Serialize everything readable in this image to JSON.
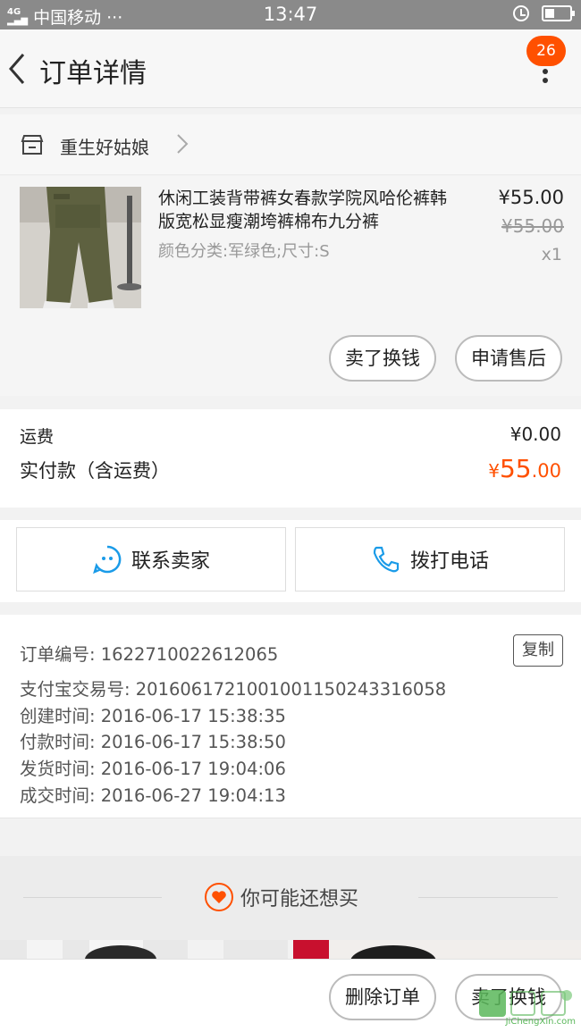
{
  "status_bar": {
    "signal": "4G⁯  ıll",
    "carrier": "中国移动 ···",
    "time": "13:47"
  },
  "nav": {
    "title": "订单详情",
    "badge_count": "26"
  },
  "shop": {
    "name": "重生好姑娘"
  },
  "item": {
    "title": "休闲工装背带裤女春款学院风哈伦裤韩版宽松显瘦潮垮裤棉布九分裤",
    "sku": "颜色分类:军绿色;尺寸:S",
    "price": "¥55.00",
    "original_price": "¥55.00",
    "quantity": "x1",
    "sell_button": "卖了换钱",
    "after_sale_button": "申请售后"
  },
  "totals": {
    "shipping_label": "运费",
    "shipping_value": "¥0.00",
    "paid_label": "实付款（含运费）",
    "paid_currency": "¥",
    "paid_integer": "55",
    "paid_decimal": ".00"
  },
  "actions": {
    "contact_seller": "联系卖家",
    "call_phone": "拨打电话"
  },
  "order_info": {
    "order_no": "订单编号: 1622710022612065",
    "copy_button": "复制",
    "alipay_no": "支付宝交易号: 2016061721001001150243316058",
    "created": "创建时间: 2016-06-17 15:38:35",
    "paid": "付款时间: 2016-06-17 15:38:50",
    "shipped": "发货时间: 2016-06-17 19:04:06",
    "completed": "成交时间: 2016-06-27 19:04:13"
  },
  "recommend": {
    "title": "你可能还想买"
  },
  "bottom": {
    "delete_order": "删除订单",
    "sell_for_cash": "卖了换钱"
  },
  "watermark": {
    "text": "JiChengXin.com"
  },
  "colors": {
    "accent": "#ff5000",
    "link_blue": "#1a9be8"
  }
}
